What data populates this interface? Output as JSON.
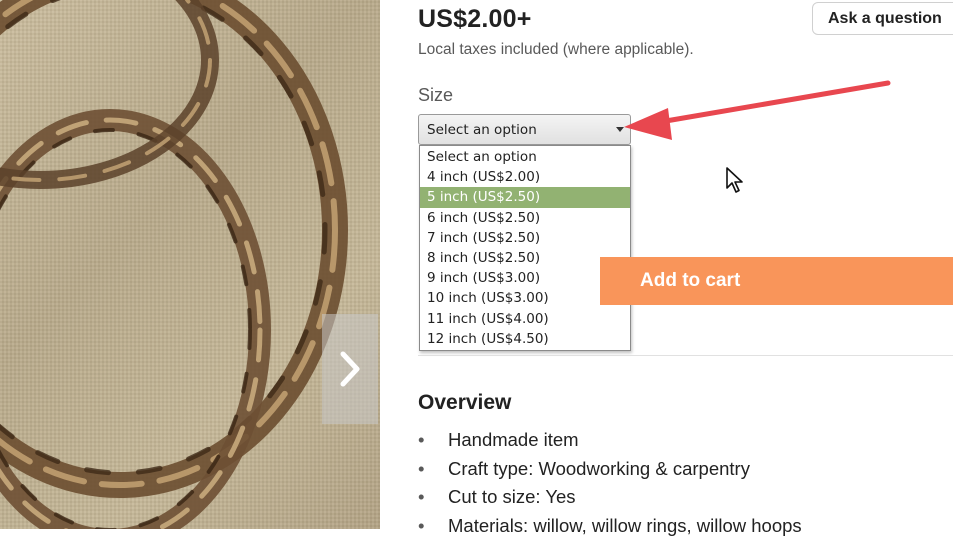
{
  "product": {
    "price": "US$2.00+",
    "tax_note": "Local taxes included (where applicable).",
    "ask_button": "Ask a question"
  },
  "size_select": {
    "label": "Size",
    "current_value": "Select an option",
    "options": [
      "Select an option",
      "4 inch (US$2.00)",
      "5 inch (US$2.50)",
      "6 inch (US$2.50)",
      "7 inch (US$2.50)",
      "8 inch (US$2.50)",
      "9 inch (US$3.00)",
      "10 inch (US$3.00)",
      "11 inch (US$4.00)",
      "12 inch (US$4.50)"
    ],
    "highlighted_option": "5 inch (US$2.50)"
  },
  "cart": {
    "add_label": "Add to cart"
  },
  "overview": {
    "title": "Overview",
    "items": [
      "Handmade item",
      "Craft type: Woodworking & carpentry",
      "Cut to size: Yes",
      "Materials: willow, willow rings, willow hoops"
    ]
  },
  "icons": {
    "carousel_next": "chevron-right-icon",
    "cursor": "mouse-pointer-icon",
    "annotation": "red-arrow-annotation"
  },
  "colors": {
    "accent_cart": "#f9955a",
    "option_highlight": "#92b272",
    "annotation_arrow": "#e8474f"
  }
}
